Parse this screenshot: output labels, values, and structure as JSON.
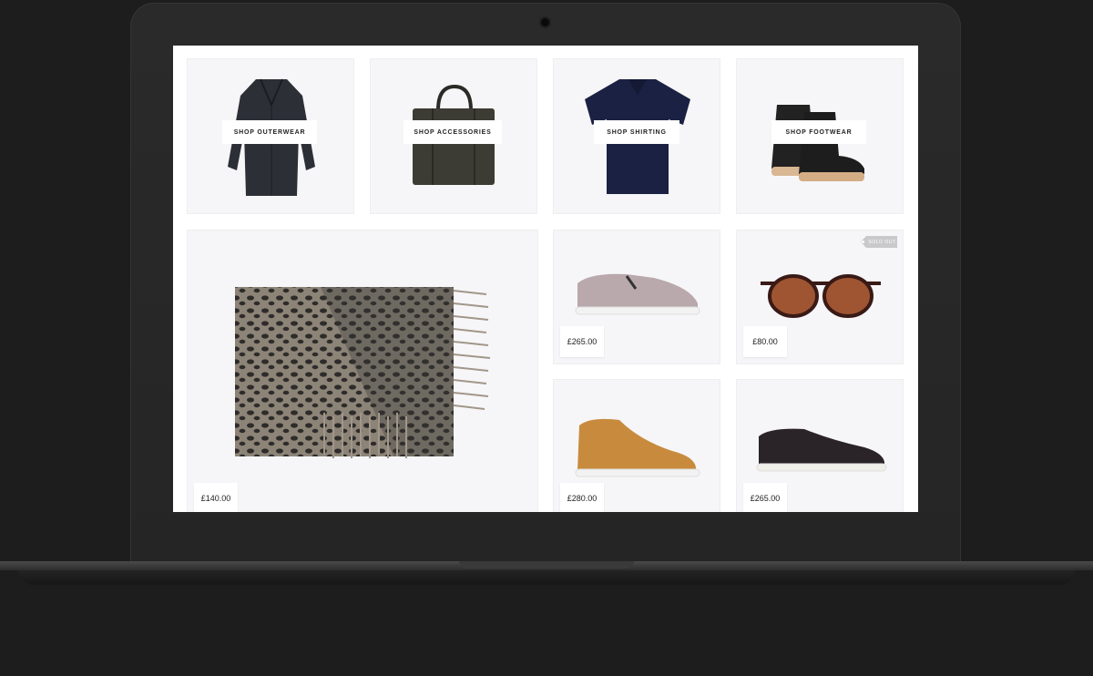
{
  "categories": [
    {
      "label": "Shop Outerwear",
      "icon": "coat-icon"
    },
    {
      "label": "Shop Accessories",
      "icon": "tote-bag-icon"
    },
    {
      "label": "Shop Shirting",
      "icon": "polo-shirt-icon"
    },
    {
      "label": "Shop Footwear",
      "icon": "boots-icon"
    }
  ],
  "products": [
    {
      "name": "scarf",
      "price": "£140.00",
      "icon": "scarf-icon"
    },
    {
      "name": "slip-on sneaker",
      "price": "£265.00",
      "icon": "slip-on-sneaker-icon"
    },
    {
      "name": "sunglasses",
      "price": "£80.00",
      "icon": "sunglasses-icon",
      "badge": "Sold out"
    },
    {
      "name": "suede mid sneaker",
      "price": "£280.00",
      "icon": "suede-sneaker-icon"
    },
    {
      "name": "leather sneaker",
      "price": "£265.00",
      "icon": "leather-sneaker-icon"
    }
  ],
  "colors": {
    "tile_bg": "#f6f6f8",
    "device_body": "#252525",
    "label_text": "#222222",
    "badge_bg": "#c9c9cc"
  }
}
